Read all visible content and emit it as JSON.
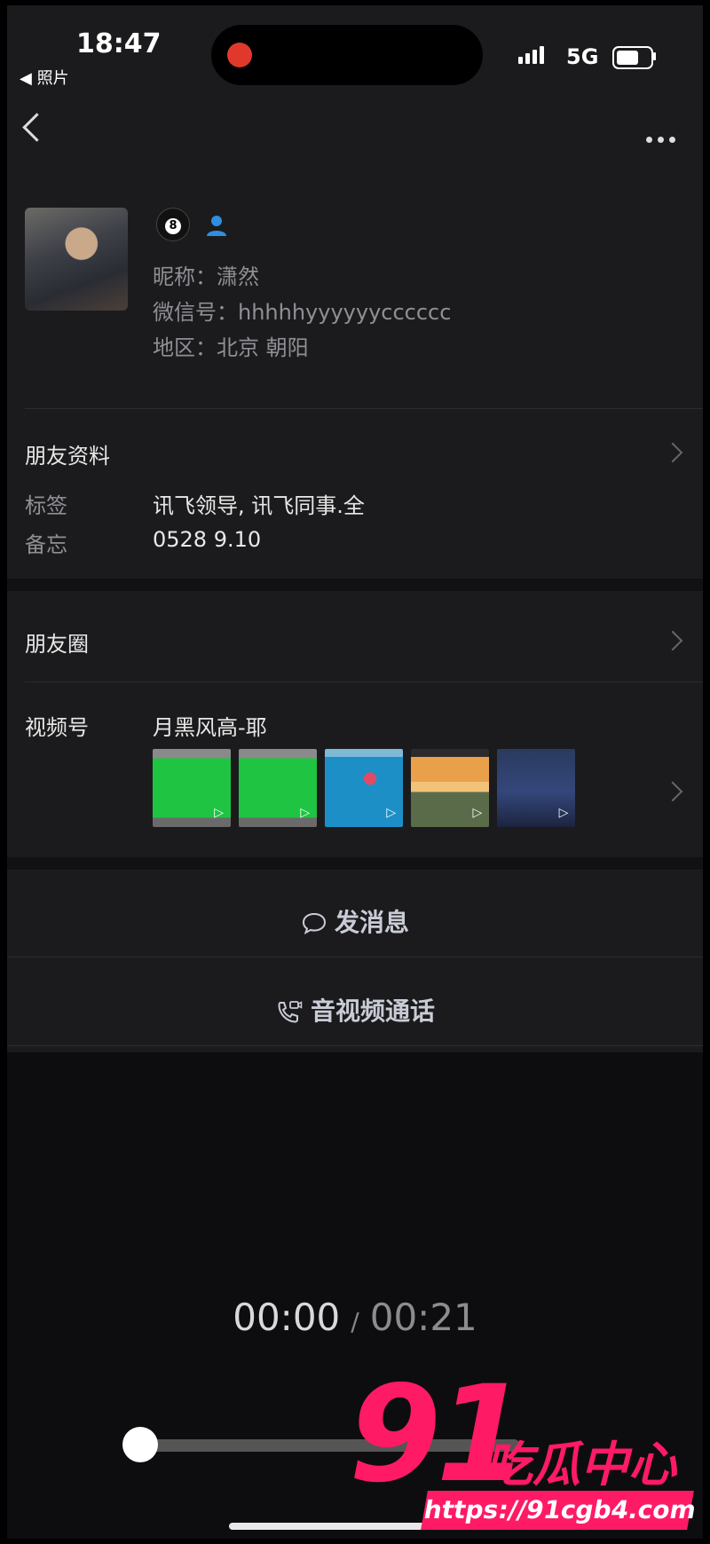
{
  "status_bar": {
    "time": "18:47",
    "back_app": "◀ 照片",
    "network": "5G"
  },
  "nav": {
    "back_icon": "chevron-left-icon",
    "more_icon": "more-dots-icon"
  },
  "profile": {
    "badge_icon": "billiard-ball-icon",
    "badge_number": "8",
    "contact_icon": "person-icon",
    "nickname": "昵称：潇然",
    "wechat_id": "微信号：hhhhhyyyyyycccccc",
    "region": "地区：北京 朝阳"
  },
  "friend_info": {
    "title": "朋友资料",
    "rows": [
      {
        "label": "标签",
        "value": "讯飞领导, 讯飞同事.全"
      },
      {
        "label": "备忘",
        "value": "0528   9.10"
      }
    ]
  },
  "moments": {
    "title": "朋友圈"
  },
  "channels": {
    "title": "视频号",
    "name": "月黑风高-耶",
    "thumb_count": 5
  },
  "actions": {
    "message": "发消息",
    "call": "音视频通话"
  },
  "playback": {
    "current": "00:00",
    "separator": "/",
    "duration": "00:21",
    "progress": 0.0
  },
  "watermark": {
    "number": "91",
    "text": "吃瓜中心",
    "url": "https://91cgb4.com"
  },
  "colors": {
    "background": "#1b1b1d",
    "accent": "#ff1a66",
    "record": "#e0392b"
  }
}
